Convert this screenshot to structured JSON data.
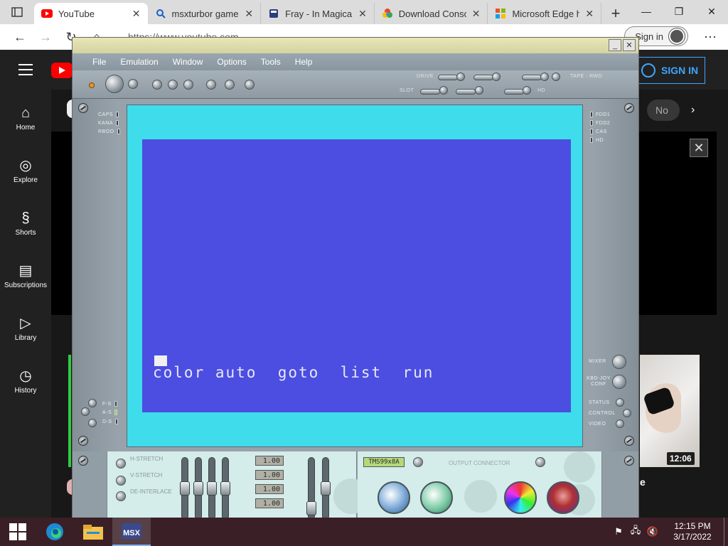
{
  "browser": {
    "tabs": [
      {
        "title": "YouTube",
        "active": true,
        "icon": "youtube-icon"
      },
      {
        "title": "msxturbor games",
        "active": false,
        "icon": "search-icon"
      },
      {
        "title": "Fray - In Magical",
        "active": false,
        "icon": "page-icon"
      },
      {
        "title": "Download Conso",
        "active": false,
        "icon": "google-photos-icon"
      },
      {
        "title": "Microsoft Edge h",
        "active": false,
        "icon": "microsoft-icon"
      }
    ],
    "url": "https://www.youtube.com",
    "sign_in_label": "Sign in"
  },
  "youtube": {
    "sign_in_label": "SIGN IN",
    "sidebar": [
      {
        "label": "Home",
        "icon": "home-icon"
      },
      {
        "label": "Explore",
        "icon": "compass-icon"
      },
      {
        "label": "Shorts",
        "icon": "shorts-icon"
      },
      {
        "label": "Subscriptions",
        "icon": "subscriptions-icon"
      },
      {
        "label": "Library",
        "icon": "library-icon"
      },
      {
        "label": "History",
        "icon": "history-icon"
      }
    ],
    "chip_label": "No",
    "video_duration": "12:06",
    "partial_title": "e"
  },
  "emulator": {
    "menu": [
      "File",
      "Emulation",
      "Window",
      "Options",
      "Tools",
      "Help"
    ],
    "toolbar_labels": {
      "drive": "DRIVE",
      "slot": "SLOT",
      "tape": "TAPE",
      "rwd": "RWD",
      "hd": "HD"
    },
    "left_leds": [
      "CAPS",
      "KANA",
      "RBOO"
    ],
    "right_leds": [
      "FDD1",
      "FDD2",
      "CAS",
      "HD"
    ],
    "left_lower_labels": [
      "F-S",
      "A-S",
      "D-S"
    ],
    "right_lower_labels": [
      "MIXER",
      "KBD-JOY CONF",
      "STATUS",
      "CONTROL",
      "VIDEO"
    ],
    "screen": {
      "function_keys": "color auto  goto  list  run",
      "border_color": "#3fdcec",
      "bg_color": "#4b4ee0"
    },
    "video_options": [
      "H-STRETCH",
      "V-STRETCH",
      "DE-INTERLACE"
    ],
    "lcd_values": [
      "1.00",
      "1.00",
      "1.00",
      "1.00"
    ],
    "vdp_chip": "TMS99x8A",
    "output_connector": "OUTPUT CONNECTOR"
  },
  "taskbar": {
    "time": "12:15 PM",
    "date": "3/17/2022",
    "apps": [
      "edge-icon",
      "file-explorer-icon",
      "bluemsx-icon"
    ]
  }
}
